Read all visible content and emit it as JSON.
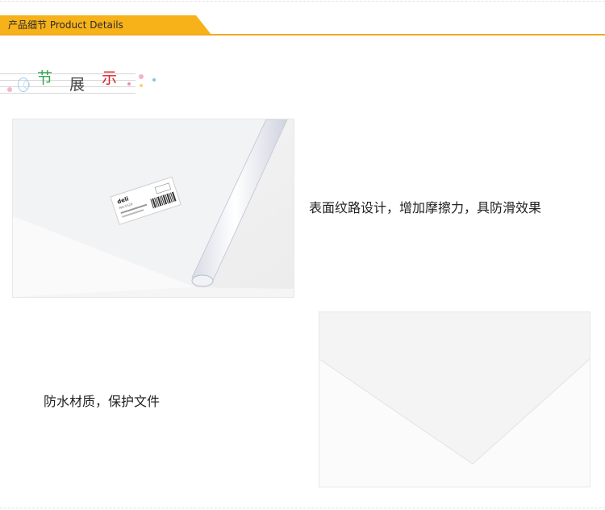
{
  "header": {
    "title": "产品细节 Product Details",
    "accent_color": "#f7b21a"
  },
  "section_heading": {
    "chars": [
      "节",
      "展",
      "示"
    ],
    "colors": [
      "#2fa84f",
      "#444444",
      "#d8232a"
    ]
  },
  "details": [
    {
      "caption": "表面纹路设计，增加摩擦力，具防滑效果",
      "label": {
        "brand": "deli",
        "code": "NO.5520"
      }
    },
    {
      "caption": "防水材质，保护文件"
    }
  ]
}
